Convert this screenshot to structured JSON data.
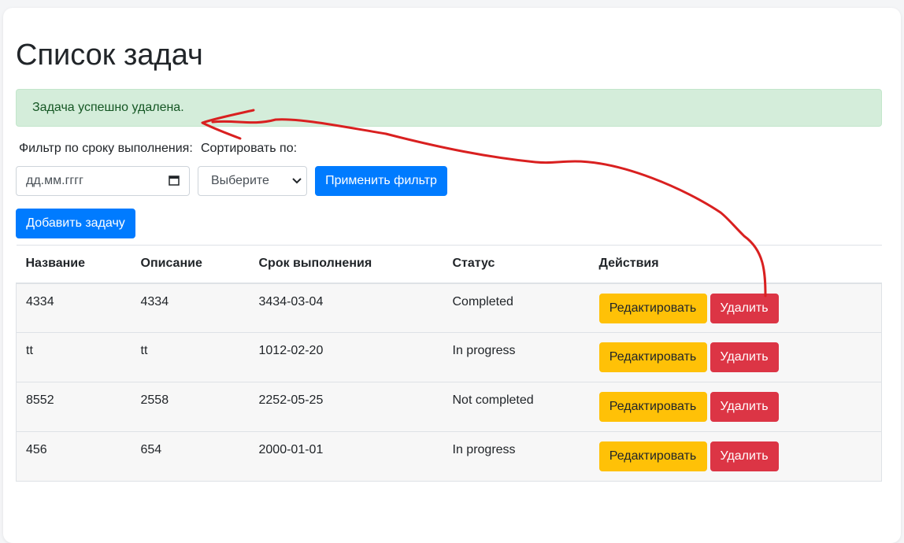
{
  "page": {
    "title": "Список задач",
    "alert_message": "Задача успешно удалена."
  },
  "filters": {
    "date_label": "Фильтр по сроку выполнения:",
    "date_placeholder": "дд.мм.гггг",
    "sort_label": "Сортировать по:",
    "sort_selected": "Выберите",
    "apply_button": "Применить фильтр"
  },
  "add_button": "Добавить задачу",
  "table": {
    "headers": [
      "Название",
      "Описание",
      "Срок выполнения",
      "Статус",
      "Действия"
    ],
    "rows": [
      {
        "name": "4334",
        "description": "4334",
        "deadline": "3434-03-04",
        "status": "Completed",
        "edit": "Редактировать",
        "delete": "Удалить"
      },
      {
        "name": "tt",
        "description": "tt",
        "deadline": "1012-02-20",
        "status": "In progress",
        "edit": "Редактировать",
        "delete": "Удалить"
      },
      {
        "name": "8552",
        "description": "2558",
        "deadline": "2252-05-25",
        "status": "Not completed",
        "edit": "Редактировать",
        "delete": "Удалить"
      },
      {
        "name": "456",
        "description": "654",
        "deadline": "2000-01-01",
        "status": "In progress",
        "edit": "Редактировать",
        "delete": "Удалить"
      }
    ]
  },
  "colors": {
    "primary": "#007bff",
    "warning": "#ffc107",
    "danger": "#dc3545",
    "success_bg": "#d4edda",
    "success_text": "#155724",
    "annotation": "#d92020"
  },
  "icons": {
    "calendar": "calendar-icon",
    "dropdown": "chevron-down-icon"
  }
}
